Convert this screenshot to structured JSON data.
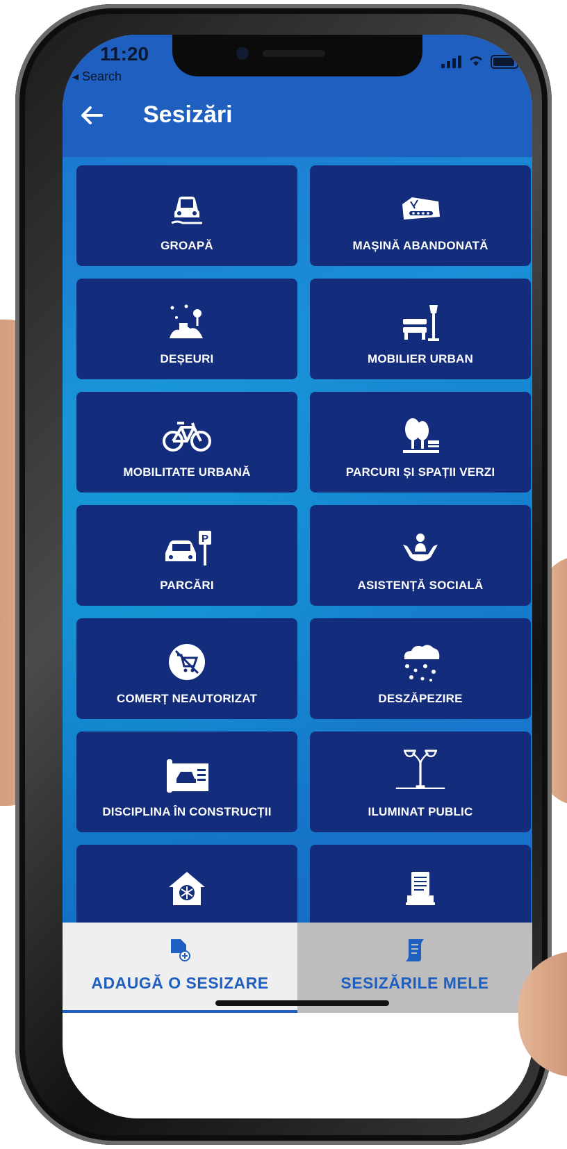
{
  "status": {
    "time": "11:20",
    "back_label": "◂ Search"
  },
  "header": {
    "title": "Sesizări"
  },
  "categories": [
    {
      "label": "GROAPĂ",
      "icon": "car-pothole-icon"
    },
    {
      "label": "MAȘINĂ ABANDONATĂ",
      "icon": "abandoned-car-icon"
    },
    {
      "label": "DEȘEURI",
      "icon": "waste-icon"
    },
    {
      "label": "MOBILIER URBAN",
      "icon": "bench-lamp-icon"
    },
    {
      "label": "MOBILITATE URBANĂ",
      "icon": "bicycle-icon"
    },
    {
      "label": "PARCURI ȘI SPAȚII VERZI",
      "icon": "trees-bench-icon"
    },
    {
      "label": "PARCĂRI",
      "icon": "parking-car-icon"
    },
    {
      "label": "ASISTENȚĂ SOCIALĂ",
      "icon": "hands-person-icon"
    },
    {
      "label": "COMERȚ NEAUTORIZAT",
      "icon": "no-cart-icon"
    },
    {
      "label": "DESZĂPEZIRE",
      "icon": "snow-cloud-icon"
    },
    {
      "label": "DISCIPLINA ÎN CONSTRUCȚII",
      "icon": "blueprint-icon"
    },
    {
      "label": "ILUMINAT PUBLIC",
      "icon": "street-lamp-icon"
    },
    {
      "label": "",
      "icon": "house-snowflake-icon"
    },
    {
      "label": "",
      "icon": "document-tray-icon"
    }
  ],
  "tabs": {
    "add": {
      "label": "ADAUGĂ O SESIZARE",
      "icon": "add-document-icon"
    },
    "mine": {
      "label": "SESIZĂRILE MELE",
      "icon": "scroll-icon"
    }
  },
  "colors": {
    "appbar": "#1f5fbf",
    "tile": "#132c7c",
    "tab_active_bg": "#efefef",
    "tab_inactive_bg": "#bdbdbd",
    "tab_text": "#1f5fbf"
  }
}
